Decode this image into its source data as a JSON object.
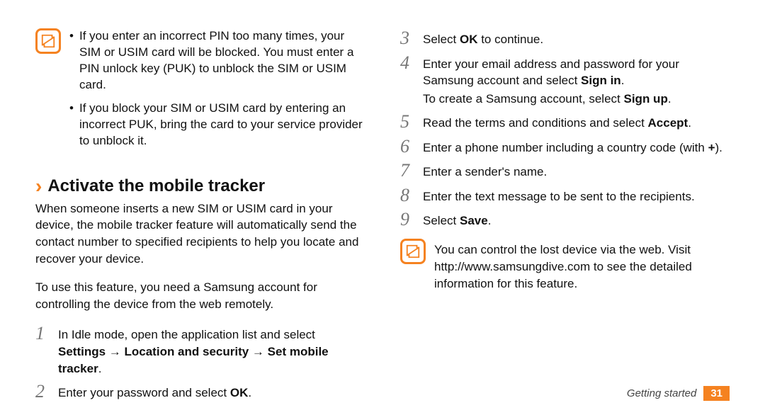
{
  "left": {
    "note1": {
      "bullets": [
        "If you enter an incorrect PIN too many times, your SIM or USIM card will be blocked. You must enter a PIN unlock key (PUK) to unblock the SIM or USIM card.",
        "If you block your SIM or USIM card by entering an incorrect PUK, bring the card to your service provider to unblock it."
      ]
    },
    "heading": "Activate the mobile tracker",
    "p1": "When someone inserts a new SIM or USIM card in your device, the mobile tracker feature will automatically send the contact number to specified recipients to help you locate and recover your device.",
    "p2": "To use this feature, you need a Samsung account for controlling the device from the web remotely.",
    "steps": {
      "s1": {
        "num": "1",
        "a": "In Idle mode, open the application list and select ",
        "b": "Settings → Location and security → Set mobile tracker",
        "c": "."
      },
      "s2": {
        "num": "2",
        "a": "Enter your password and select ",
        "b": "OK",
        "c": "."
      }
    }
  },
  "right": {
    "steps": {
      "s3": {
        "num": "3",
        "a": "Select ",
        "b": "OK",
        "c": " to continue."
      },
      "s4": {
        "num": "4",
        "a": "Enter your email address and password for your Samsung account and select ",
        "b": "Sign in",
        "c": ".",
        "sub_a": "To create a Samsung account, select ",
        "sub_b": "Sign up",
        "sub_c": "."
      },
      "s5": {
        "num": "5",
        "a": "Read the terms and conditions and select ",
        "b": "Accept",
        "c": "."
      },
      "s6": {
        "num": "6",
        "a": "Enter a phone number including a country code (with ",
        "b": "+",
        "c": ")."
      },
      "s7": {
        "num": "7",
        "a": "Enter a sender's name."
      },
      "s8": {
        "num": "8",
        "a": "Enter the text message to be sent to the recipients."
      },
      "s9": {
        "num": "9",
        "a": "Select ",
        "b": "Save",
        "c": "."
      }
    },
    "note2": {
      "text": "You can control the lost device via the web. Visit http://www.samsungdive.com to see the detailed information for this feature."
    }
  },
  "footer": {
    "section": "Getting started",
    "page": "31"
  }
}
